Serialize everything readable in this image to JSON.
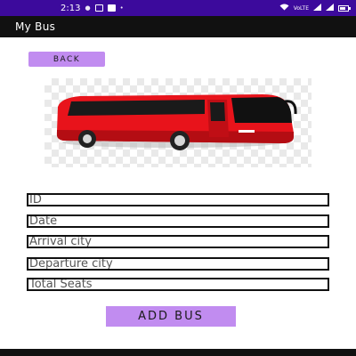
{
  "status_bar": {
    "time": "2:13",
    "right_text": "VoLTE",
    "accent_color": "#3c0a9c"
  },
  "app_bar": {
    "title": "My Bus"
  },
  "back_button": {
    "label": "BACK"
  },
  "bus_image": {
    "icon": "bus-illustration",
    "color": "#e8131b"
  },
  "form": {
    "id": {
      "placeholder": "ID",
      "value": ""
    },
    "date": {
      "placeholder": "Date",
      "value": ""
    },
    "arrival_city": {
      "placeholder": "Arrival city",
      "value": ""
    },
    "departure_city": {
      "placeholder": "Departure city",
      "value": ""
    },
    "total_seats": {
      "placeholder": "Total Seats",
      "value": ""
    }
  },
  "add_button": {
    "label": "ADD BUS",
    "color": "#c18cf0"
  }
}
